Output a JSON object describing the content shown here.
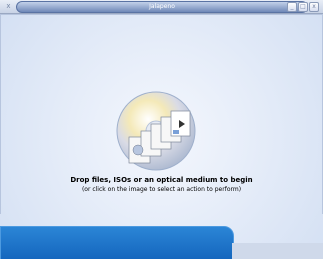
{
  "window": {
    "title": "Jalapeno",
    "close_label": "x",
    "btn_min": "_",
    "btn_max": "□",
    "btn_close": "x"
  },
  "main": {
    "instruction": "Drop files, ISOs or an optical medium to begin",
    "subinstruction": "(or click on the image to select an action to perform)"
  },
  "icons": {
    "disc": "optical-disc-icon",
    "documents": "document-stack-icon"
  }
}
